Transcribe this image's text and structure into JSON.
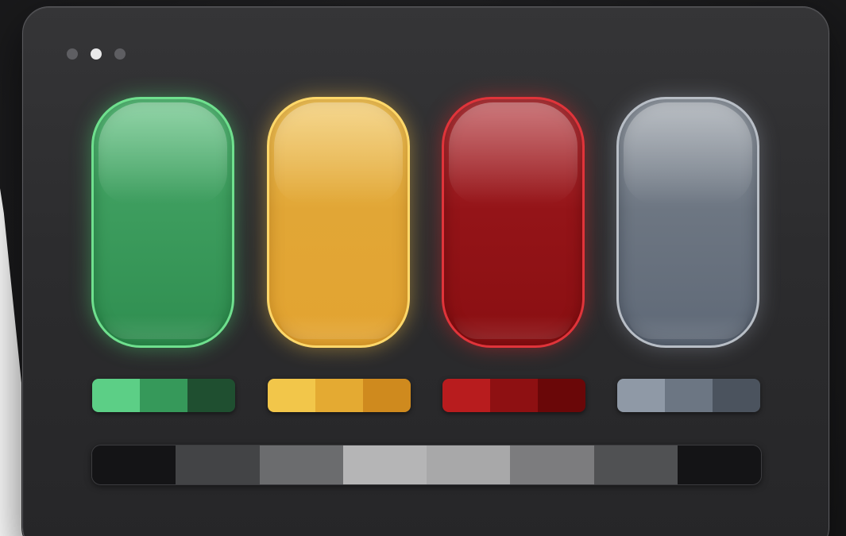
{
  "window_controls": [
    {
      "name": "control-1",
      "state": "inactive"
    },
    {
      "name": "control-2",
      "state": "active"
    },
    {
      "name": "control-3",
      "state": "inactive"
    }
  ],
  "pills": [
    {
      "name": "green",
      "color": "#3e9e5f",
      "border": "#6fe08e"
    },
    {
      "name": "yellow",
      "color": "#e1a636",
      "border": "#ffd86a"
    },
    {
      "name": "red",
      "color": "#941418",
      "border": "#e0343a"
    },
    {
      "name": "gray",
      "color": "#6d7682",
      "border": "#b8bec6"
    }
  ],
  "swatch_rows": {
    "green": [
      "#5ccf86",
      "#36995a",
      "#1f4f30"
    ],
    "yellow": [
      "#f2c64a",
      "#e4aa32",
      "#cf8a1e"
    ],
    "red": [
      "#b81c1e",
      "#8e1012",
      "#6a0708"
    ],
    "gray": [
      "#8f99a6",
      "#6c7683",
      "#4b535e"
    ]
  },
  "grayscale_bar": [
    "#141416",
    "#434446",
    "#6b6c6e",
    "#b5b5b6",
    "#a8a8a9",
    "#7c7c7e",
    "#505153",
    "#141416"
  ]
}
